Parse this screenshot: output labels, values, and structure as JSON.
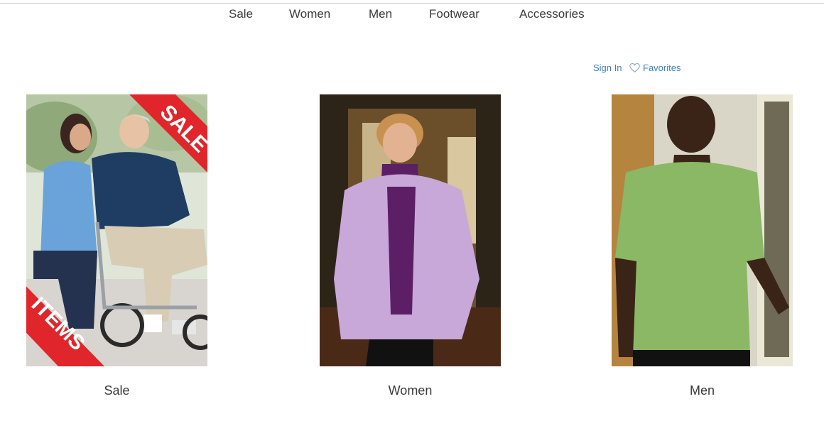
{
  "nav": {
    "items": [
      {
        "label": "Sale"
      },
      {
        "label": "Women"
      },
      {
        "label": "Men"
      },
      {
        "label": "Footwear"
      },
      {
        "label": "Accessories"
      }
    ]
  },
  "utility": {
    "sign_in": "Sign In",
    "favorites": "Favorites",
    "favorites_icon": "heart-icon"
  },
  "categories": [
    {
      "label": "Sale",
      "badge_top": "SALE",
      "badge_bottom": "ITEMS"
    },
    {
      "label": "Women"
    },
    {
      "label": "Men"
    }
  ],
  "colors": {
    "link": "#3f7fba",
    "sale_ribbon": "#e0262b",
    "nav_text": "#3a3a3a"
  }
}
